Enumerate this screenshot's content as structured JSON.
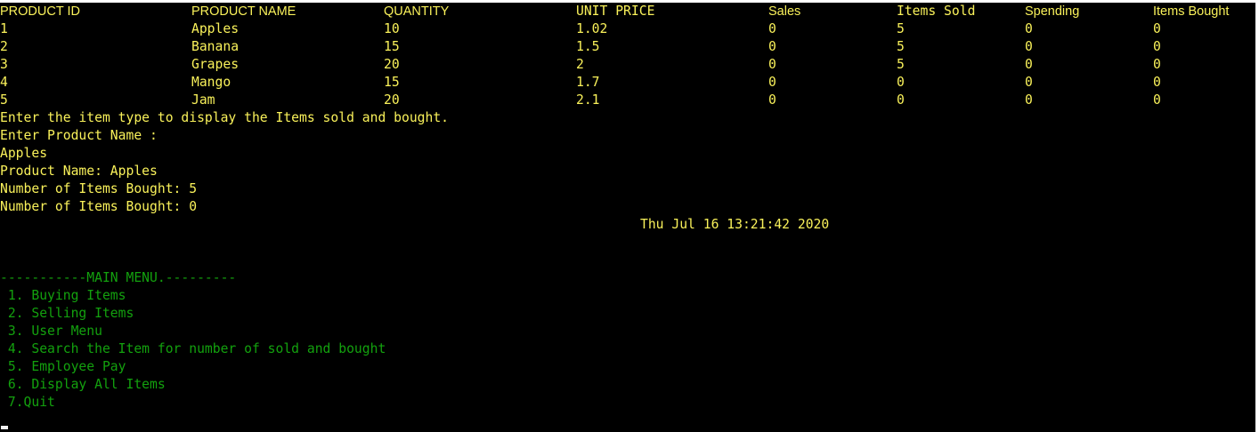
{
  "table": {
    "headers": [
      "PRODUCT ID",
      "PRODUCT NAME",
      "QUANTITY",
      "UNIT PRICE",
      "Sales",
      "Items Sold",
      "Spending",
      "Items Bought"
    ],
    "rows": [
      [
        "1",
        "Apples",
        "10",
        "1.02",
        "0",
        "5",
        "0",
        "0"
      ],
      [
        "2",
        "Banana",
        "15",
        "1.5",
        "0",
        "5",
        "0",
        "0"
      ],
      [
        "3",
        "Grapes",
        "20",
        "2",
        "0",
        "5",
        "0",
        "0"
      ],
      [
        "4",
        "Mango",
        "15",
        "1.7",
        "0",
        "0",
        "0",
        "0"
      ],
      [
        "5",
        "Jam",
        "20",
        "2.1",
        "0",
        "0",
        "0",
        "0"
      ]
    ]
  },
  "output": {
    "prompt_item_type": "Enter the item type to display the Items sold and bought.",
    "prompt_product_name": "Enter Product Name :",
    "input_value": "Apples",
    "product_name_line": "Product Name: Apples",
    "items_bought_line_1": "Number of Items Bought: 5",
    "items_bought_line_2": "Number of Items Bought: 0",
    "timestamp": "Thu Jul 16 13:21:42 2020"
  },
  "menu": {
    "title": "-----------MAIN MENU.---------",
    "items": [
      " 1. Buying Items",
      " 2. Selling Items",
      " 3. User Menu",
      " 4. Search the Item for number of sold and bought",
      " 5. Employee Pay",
      " 6. Display All Items",
      " 7.Quit"
    ]
  },
  "colors": {
    "background": "#000000",
    "text_yellow": "#f9f15a",
    "text_green": "#13a10e"
  }
}
